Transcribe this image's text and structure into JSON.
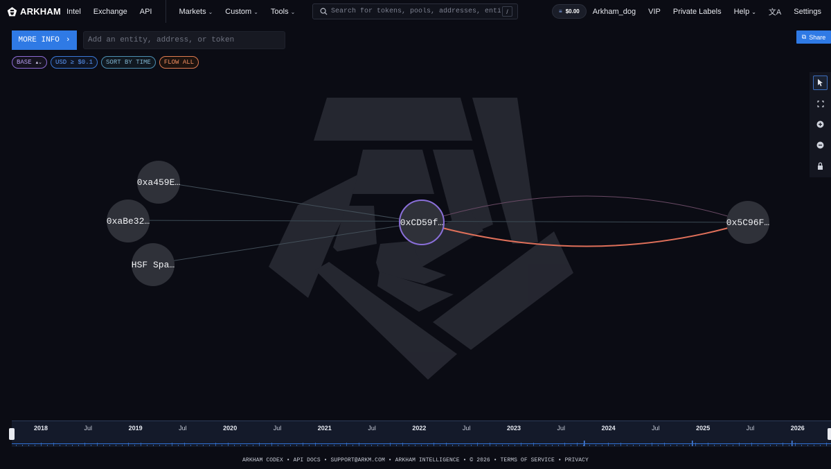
{
  "nav": {
    "brand": "ARKHAM",
    "links": [
      "Intel",
      "Exchange",
      "API"
    ],
    "dropdowns": [
      "Markets",
      "Custom",
      "Tools"
    ],
    "search_placeholder": "Search for tokens, pools, addresses, entiti…",
    "search_shortcut": "/",
    "balance": "$0.00",
    "username": "Arkham_dog",
    "vip": "VIP",
    "private_labels": "Private Labels",
    "help": "Help",
    "settings": "Settings"
  },
  "controls": {
    "more_info": "MORE INFO",
    "entity_placeholder": "Add an entity, address, or token",
    "share": "Share",
    "chips": {
      "base": "BASE",
      "usd": "USD ≥ $0.1",
      "sort": "SORT BY TIME",
      "flow": "FLOW ALL"
    }
  },
  "graph": {
    "nodes": {
      "a459": "0xa459E…",
      "abe32": "0xaBe32…",
      "hsf": "HSF Spa…",
      "center": "0xCD59f…",
      "c96f": "0x5C96F…"
    },
    "colors": {
      "center_ring": "#8a6fd9",
      "flow_out": "#e0705a",
      "flow_in": "#7a5a78"
    }
  },
  "timeline": {
    "labels": [
      "2018",
      "Jul",
      "2019",
      "Jul",
      "2020",
      "Jul",
      "2021",
      "Jul",
      "2022",
      "Jul",
      "2023",
      "Jul",
      "2024",
      "Jul",
      "2025",
      "Jul",
      "2026"
    ]
  },
  "footer": {
    "items": [
      "ARKHAM CODEX",
      "API DOCS",
      "SUPPORT@ARKM.COM",
      "ARKHAM INTELLIGENCE",
      "© 2026",
      "TERMS OF SERVICE",
      "PRIVACY"
    ]
  }
}
